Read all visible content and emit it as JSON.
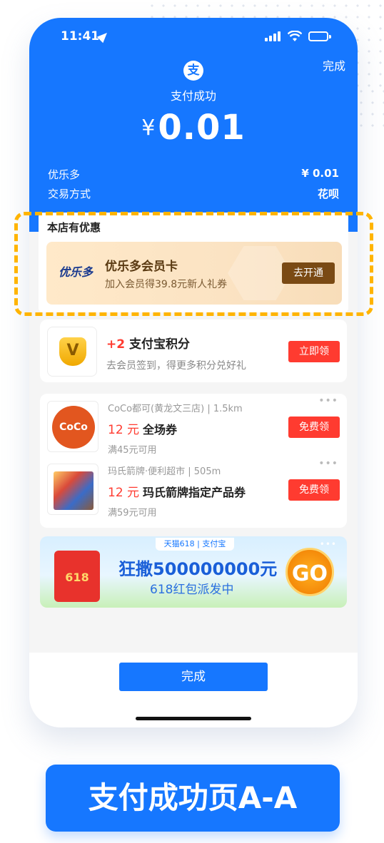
{
  "status_bar": {
    "time": "11:41"
  },
  "header": {
    "done": "完成",
    "logo_glyph": "支",
    "title": "支付成功",
    "currency": "¥",
    "amount": "0.01",
    "merchant_label": "优乐多",
    "merchant_amount": "¥ 0.01",
    "method_label": "交易方式",
    "method_value": "花呗",
    "brand_color": "#1677ff"
  },
  "promo": {
    "section_title": "本店有优惠",
    "logo_text": "优乐多",
    "card_name": "优乐多会员卡",
    "card_sub": "加入会员得39.8元新人礼券",
    "button": "去开通",
    "highlight_color": "#ffb400"
  },
  "points": {
    "icon_glyph": "V",
    "plus": "+2",
    "title": "支付宝积分",
    "sub": "去会员签到，得更多积分兑好礼",
    "button": "立即领"
  },
  "coupons": [
    {
      "logo_text": "CoCo",
      "store": "CoCo都可(黄龙文三店) | 1.5km",
      "value": "12 元",
      "title": "全场券",
      "condition": "满45元可用",
      "button": "免费领",
      "more": "•••"
    },
    {
      "store": "玛氏箭牌·便利超市 | 505m",
      "value": "12 元",
      "title": "玛氏箭牌指定产品券",
      "condition": "满59元可用",
      "button": "免费领",
      "more": "•••"
    }
  ],
  "banner": {
    "tag": "天猫618 | 支付宝",
    "redpack": "618",
    "main": "狂撒500000000元",
    "sub": "618红包派发中",
    "go": "GO",
    "more": "•••"
  },
  "footer": {
    "done": "完成"
  },
  "caption": "支付成功页A-A"
}
